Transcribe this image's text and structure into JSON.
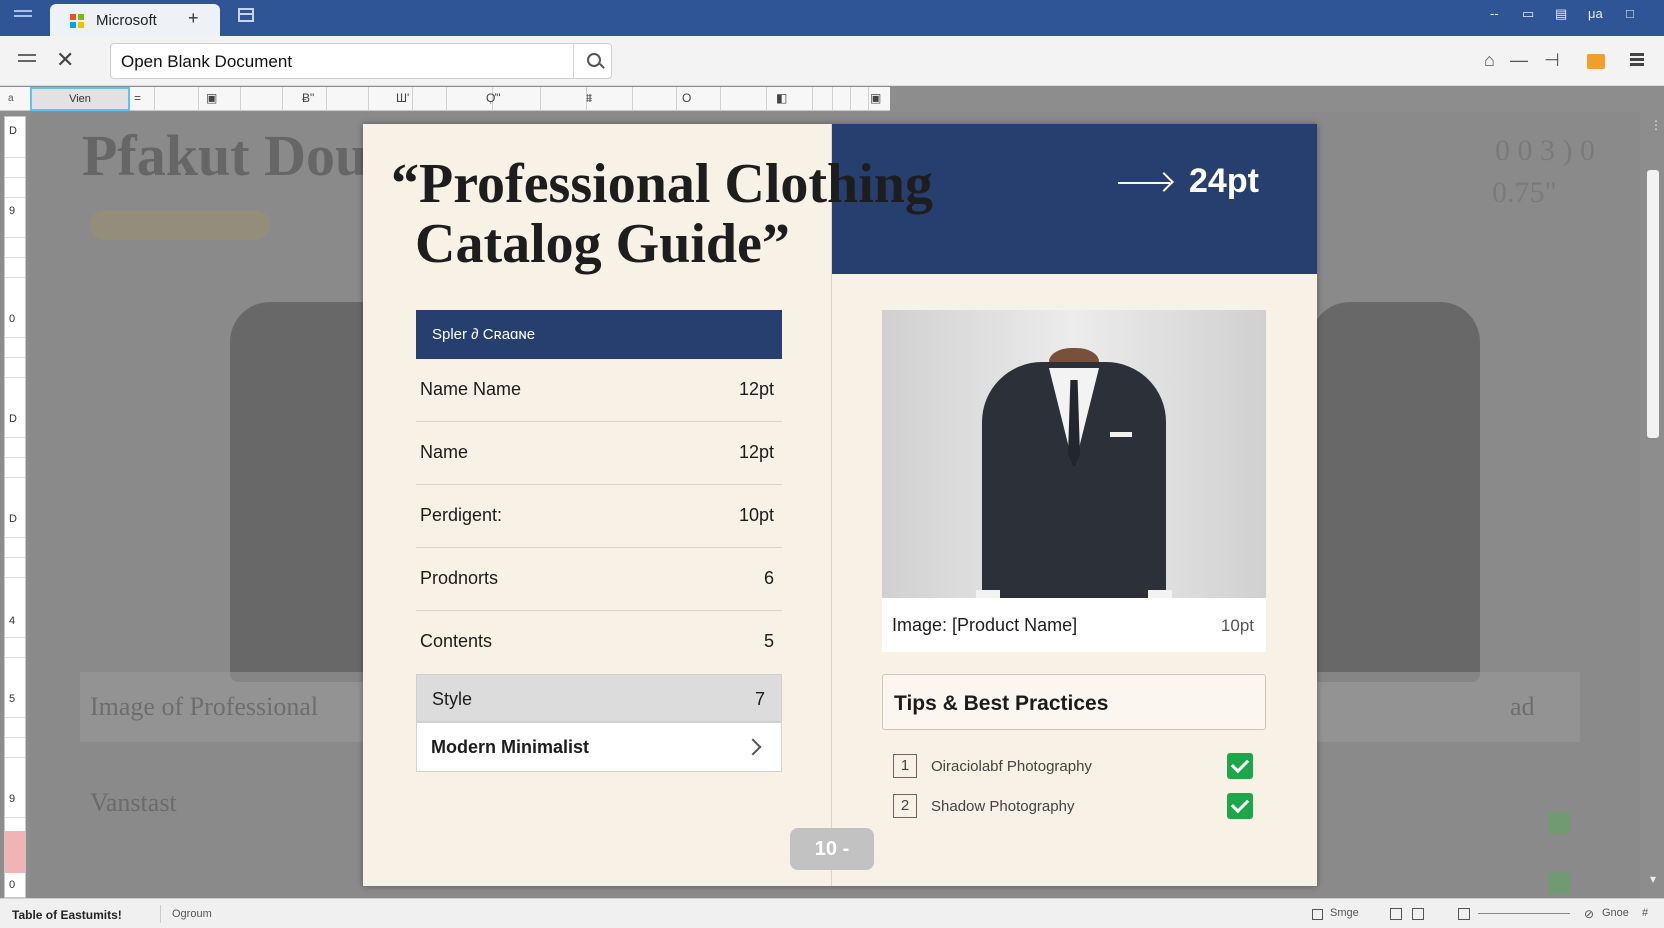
{
  "window": {
    "tab_title": "Microsoft",
    "tab_add": "+",
    "controls": [
      "--",
      "▭",
      "▤",
      "μa",
      "□"
    ]
  },
  "toolbar": {
    "close_glyph": "✕",
    "address_text": "Open Blank Document",
    "right_icons": [
      "lock-icon",
      "minus-icon",
      "pin-icon",
      "folder-icon",
      "stack-icon"
    ]
  },
  "ruler": {
    "view_label": "Vien",
    "corner_label": "a",
    "symbols": [
      "=",
      "▣",
      "Ƀ\"",
      "Ш'",
      "Ợ\"",
      "⩩",
      "O",
      "◧",
      "▣"
    ]
  },
  "vertical_ruler": {
    "numbers": [
      "D",
      "9",
      "0",
      "D",
      "D",
      "4",
      "5",
      "9",
      "0"
    ]
  },
  "background_page": {
    "title": "Pfakut Dou",
    "caption": "Image of Professional",
    "label": "Vanstast",
    "right_value": "0.75\"",
    "right_faint": "0 0 3 ) 0",
    "right_caption": "ad"
  },
  "document": {
    "title_line1": "“Professional Clothing",
    "title_line2": "Catalog Guide”",
    "header_arrow_label": "24pt",
    "panel_title": "Spler ∂ Cʀaɑɴe",
    "rows": [
      {
        "label": "Name Name",
        "value": "12pt"
      },
      {
        "label": "Name",
        "value": "12pt"
      },
      {
        "label": "Perdigent:",
        "value": "10pt"
      },
      {
        "label": "Prodnorts",
        "value": "6"
      },
      {
        "label": "Contents",
        "value": "5"
      }
    ],
    "style_row": {
      "label": "Style",
      "value": "7"
    },
    "style_select": {
      "value": "Modern Minimalist"
    },
    "page_indicator": "10 -",
    "image_caption": {
      "label": "Image: [Product Name]",
      "value": "10pt"
    },
    "tips": {
      "title": "Tips & Best Practices",
      "items": [
        {
          "num": "1",
          "text": "Oiraciolabf Photography",
          "checked": true
        },
        {
          "num": "2",
          "text": "Shadow Photography",
          "checked": true
        }
      ]
    }
  },
  "statusbar": {
    "toc": "Table of Eastumits!",
    "pages": "Ogroum",
    "items": [
      "Smge",
      "Gnoe"
    ]
  },
  "colors": {
    "titlebar": "#2f5596",
    "header_blue": "#263f6e",
    "page_bg": "#f8f1e6",
    "check_green": "#1ea64a"
  }
}
